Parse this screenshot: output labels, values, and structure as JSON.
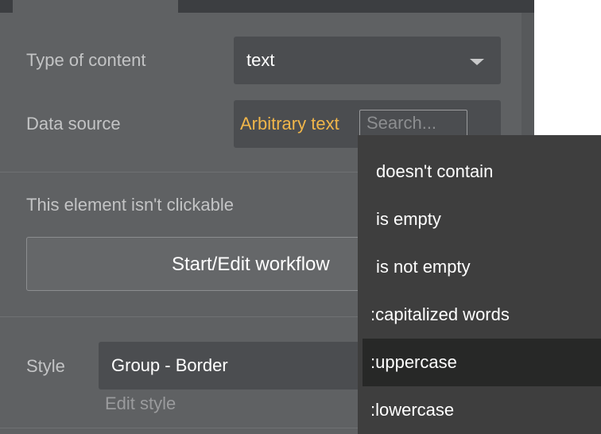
{
  "properties": {
    "type_of_content": {
      "label": "Type of content",
      "value": "text"
    },
    "data_source": {
      "label": "Data source",
      "value": "Arbitrary text",
      "search_placeholder": "Search..."
    },
    "clickable_notice": "This element isn't clickable",
    "workflow_button": "Start/Edit workflow",
    "style": {
      "label": "Style",
      "value": "Group - Border",
      "edit_link": "Edit style"
    }
  },
  "dropdown": {
    "items": [
      {
        "label": "doesn't contain"
      },
      {
        "label": "is empty"
      },
      {
        "label": "is not empty"
      },
      {
        "label": ":capitalized words"
      },
      {
        "label": ":uppercase",
        "highlighted": true
      },
      {
        "label": ":lowercase"
      }
    ]
  },
  "colors": {
    "panel_bg": "#5f6163",
    "field_bg": "#4b4d50",
    "accent_orange": "#f1b64a",
    "dropdown_bg": "#3e3e3e",
    "dropdown_highlight": "#272827"
  }
}
